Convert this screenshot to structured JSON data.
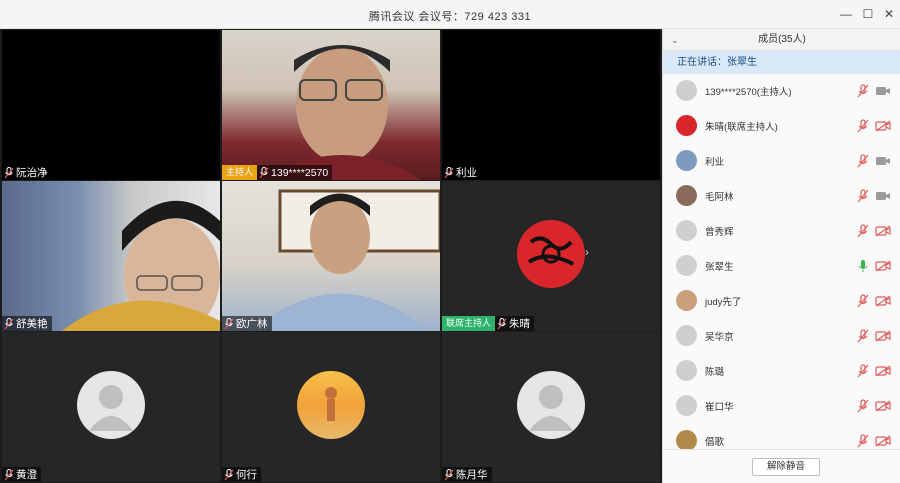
{
  "window": {
    "title": "腾讯会议  会议号：729 423 331",
    "minimize": "—",
    "maximize": "☐",
    "close": "✕"
  },
  "tiles": [
    {
      "name": "阮治净"
    },
    {
      "name": "139****2570",
      "tag": "主持人"
    },
    {
      "name": "利业"
    },
    {
      "name": "舒美艳"
    },
    {
      "name": "欧广林"
    },
    {
      "name": "朱晴",
      "tag": "联席主持人"
    },
    {
      "name": "黄澄"
    },
    {
      "name": "何行"
    },
    {
      "name": "陈月华"
    }
  ],
  "sidebar": {
    "header": "成员(35人)",
    "speaking": "正在讲话：张翠生",
    "members": [
      {
        "name": "139****2570(主持人)",
        "mic": "muted",
        "cam": "on"
      },
      {
        "name": "朱晴(联席主持人)",
        "mic": "muted",
        "cam": "off"
      },
      {
        "name": "利业",
        "mic": "muted",
        "cam": "on"
      },
      {
        "name": "毛阿林",
        "mic": "muted",
        "cam": "on"
      },
      {
        "name": "曾秀辉",
        "mic": "muted",
        "cam": "off"
      },
      {
        "name": "张翠生",
        "mic": "active",
        "cam": "off"
      },
      {
        "name": "judy先了",
        "mic": "muted",
        "cam": "off"
      },
      {
        "name": "吴华京",
        "mic": "muted",
        "cam": "off"
      },
      {
        "name": "陈璐",
        "mic": "muted",
        "cam": "off"
      },
      {
        "name": "崔口华",
        "mic": "muted",
        "cam": "off"
      },
      {
        "name": "倡歌",
        "mic": "muted",
        "cam": "off"
      }
    ],
    "unmute_all": "解除静音"
  },
  "colors": {
    "host_tag": "#e8a317",
    "cohost_tag": "#2db36b",
    "mic_muted": "#e05b5b",
    "mic_active": "#37b24d"
  }
}
